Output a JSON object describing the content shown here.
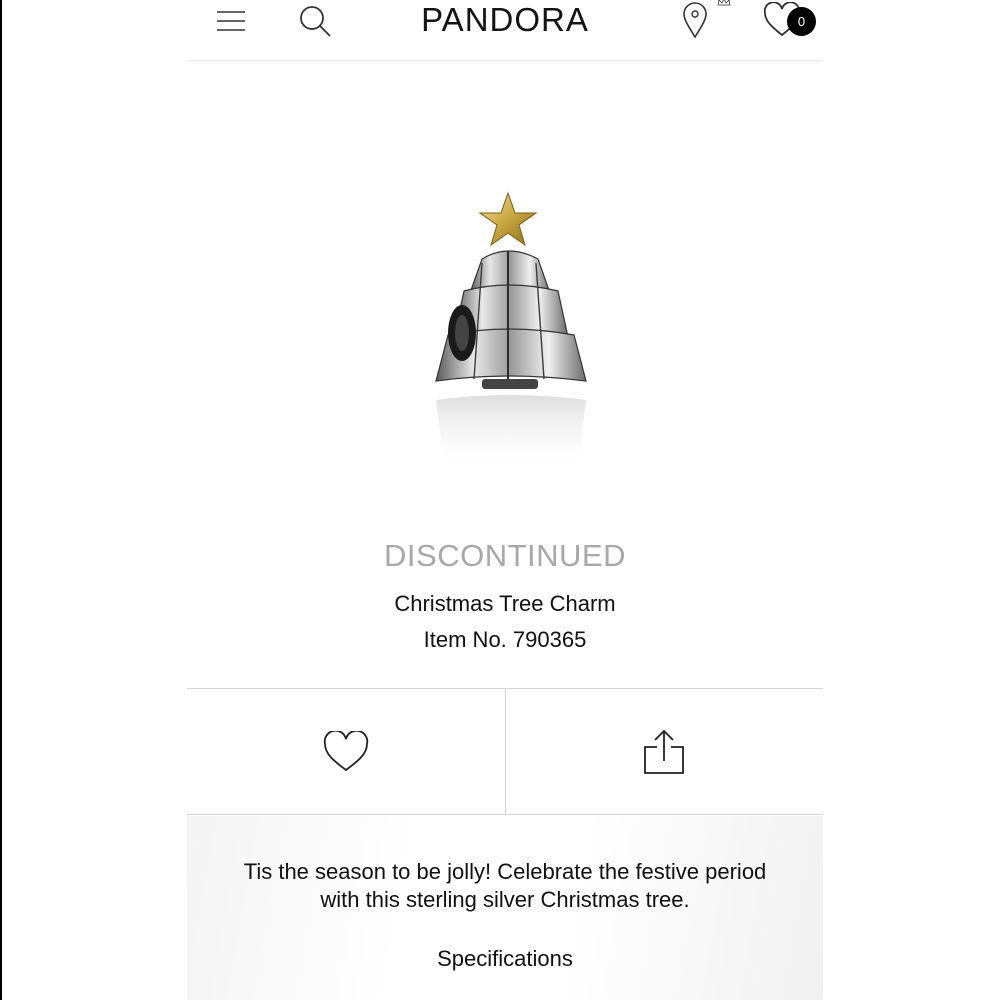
{
  "header": {
    "brand": "PANDORA",
    "wishlist_count": "0",
    "icons": {
      "menu": "menu-icon",
      "search": "search-icon",
      "location": "location-pin-icon",
      "wishlist": "heart-icon"
    }
  },
  "product": {
    "status": "DISCONTINUED",
    "name": "Christmas Tree Charm",
    "item_number": "Item No. 790365",
    "image": "christmas-tree-charm-image"
  },
  "actions": {
    "favorite_icon": "heart-outline-icon",
    "share_icon": "share-icon"
  },
  "details": {
    "description": "Tis the season to be jolly! Celebrate the festive period with this sterling silver Christmas tree.",
    "specifications_label": "Specifications"
  },
  "colors": {
    "status_gray": "#a8a8a8",
    "text": "#111111",
    "divider": "#d4d4d4",
    "badge_bg": "#000000"
  }
}
